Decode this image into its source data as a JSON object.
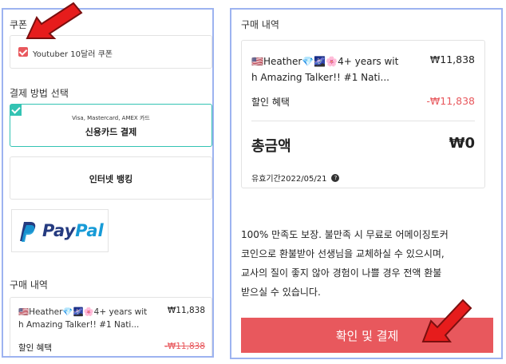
{
  "left": {
    "coupon_title": "쿠폰",
    "coupon_label": "Youtuber 10달러 쿠폰",
    "payment_title": "결제 방법 선택",
    "card_brands": "Visa, Mastercard, AMEX 카드",
    "card_label": "신용카드 결제",
    "bank_label": "인터넷 뱅킹",
    "paypal_label": "PayPal",
    "purchase_title": "구매 내역",
    "item_line1": "🇺🇸Heather💎🌌🌸4+ years wit",
    "item_line2": "h Amazing Talker!! #1 Nati...",
    "item_price": "₩11,838",
    "discount_label": "할인 혜택",
    "discount_value": "-₩11,838"
  },
  "right": {
    "purchase_title": "구매 내역",
    "item_line1": "🇺🇸Heather💎🌌🌸4+ years wit",
    "item_line2": "h Amazing Talker!! #1 Nati...",
    "item_price": "₩11,838",
    "discount_label": "할인 혜택",
    "discount_value": "-₩11,838",
    "total_label": "총금액",
    "total_value": "₩0",
    "validity": "유효기간2022/05/21",
    "guarantee_line1": "100% 만족도 보장. 불만족 시 무료로 어메이징토커",
    "guarantee_line2": "코인으로 환불받아 선생님을 교체하실 수 있으시며,",
    "guarantee_line3": "교사의 질이 좋지 않아 경험이 나쁠 경우 전액 환불",
    "guarantee_line4": "받으실 수 있습니다.",
    "pay_button": "확인 및 결제"
  },
  "colors": {
    "accent_red": "#e8585d",
    "teal": "#33c3b3",
    "panel_border": "#9db3f0",
    "paypal_dark": "#253b80",
    "paypal_light": "#179bd7"
  },
  "icons": [
    "red-arrow-icon",
    "checkbox-checked-icon",
    "paypal-logo-icon",
    "help-circle-icon"
  ]
}
